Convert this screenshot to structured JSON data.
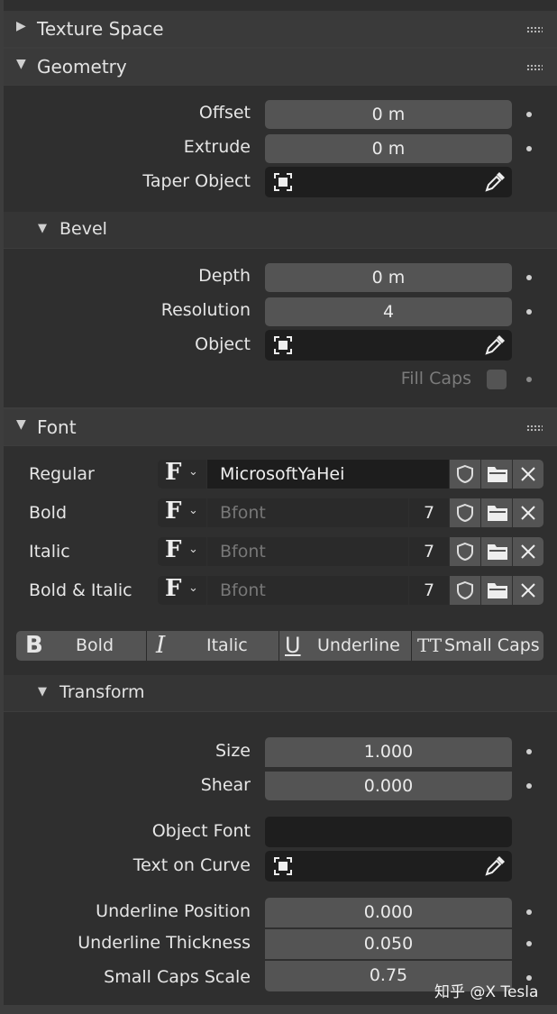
{
  "panels": {
    "texture_space": {
      "title": "Texture Space",
      "expanded": false
    },
    "geometry": {
      "title": "Geometry",
      "offset": {
        "label": "Offset",
        "value": "0 m"
      },
      "extrude": {
        "label": "Extrude",
        "value": "0 m"
      },
      "taper_object": {
        "label": "Taper Object"
      },
      "bevel": {
        "title": "Bevel",
        "depth": {
          "label": "Depth",
          "value": "0 m"
        },
        "resolution": {
          "label": "Resolution",
          "value": "4"
        },
        "object": {
          "label": "Object"
        },
        "fill_caps": {
          "label": "Fill Caps",
          "checked": false
        }
      }
    },
    "font": {
      "title": "Font",
      "rows": [
        {
          "label": "Regular",
          "font": "MicrosoftYaHei",
          "users": ""
        },
        {
          "label": "Bold",
          "font": "Bfont",
          "users": "7"
        },
        {
          "label": "Italic",
          "font": "Bfont",
          "users": "7"
        },
        {
          "label": "Bold & Italic",
          "font": "Bfont",
          "users": "7"
        }
      ],
      "style_buttons": [
        {
          "label": "Bold",
          "icon": "B"
        },
        {
          "label": "Italic",
          "icon": "I"
        },
        {
          "label": "Underline",
          "icon": "U"
        },
        {
          "label": "Small Caps",
          "icon": "TT"
        }
      ],
      "transform": {
        "title": "Transform",
        "size": {
          "label": "Size",
          "value": "1.000"
        },
        "shear": {
          "label": "Shear",
          "value": "0.000"
        },
        "object_font": {
          "label": "Object Font",
          "value": ""
        },
        "text_on_curve": {
          "label": "Text on Curve"
        },
        "underline_position": {
          "label": "Underline Position",
          "value": "0.000"
        },
        "underline_thickness": {
          "label": "Underline Thickness",
          "value": "0.050"
        },
        "small_caps_scale": {
          "label": "Small Caps Scale",
          "value": "0.75"
        }
      }
    }
  },
  "watermark": "知乎 @X Tesla",
  "colors": {
    "field": "#545454",
    "dark_field": "#1e1e1e",
    "panel": "#3a3a3a",
    "body": "#2f2f2f"
  }
}
